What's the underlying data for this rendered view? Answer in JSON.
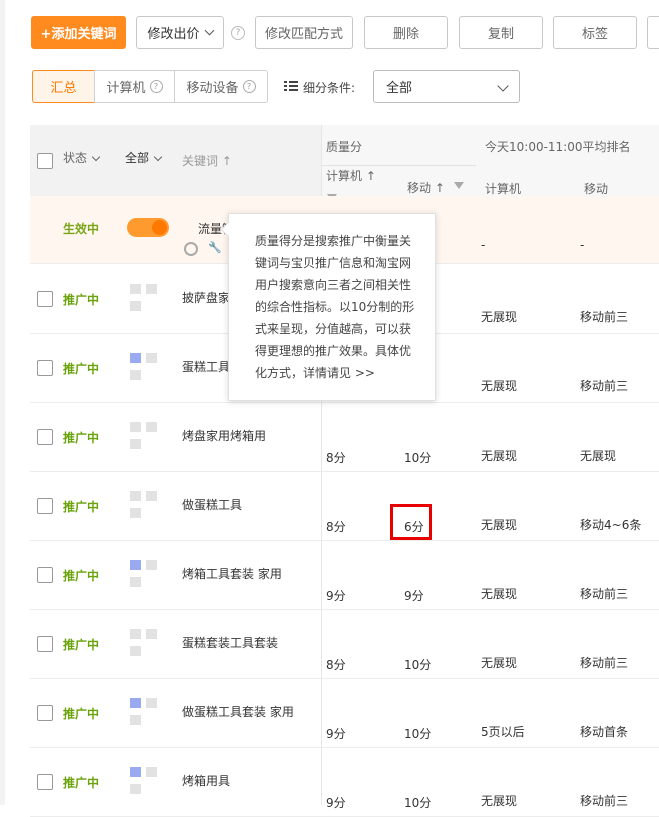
{
  "toolbar": {
    "add_label": "+添加关键词",
    "modify_bid_label": "修改出价",
    "modify_match_label": "修改匹配方式",
    "delete_label": "删除",
    "copy_label": "复制",
    "tag_label": "标签"
  },
  "filters": {
    "seg_summary": "汇总",
    "seg_computer": "计算机",
    "seg_mobile": "移动设备",
    "condition_label": "细分条件:",
    "condition_value": "全部"
  },
  "table": {
    "header": {
      "status": "状态",
      "all": "全部",
      "keyword": "关键词 ↑",
      "quality": "质量分",
      "quality_computer": "计算机 ↑",
      "quality_mobile": "移动 ↑",
      "rank_group": "今天10:00-11:00平均排名",
      "rank_computer": "计算机",
      "rank_mobile": "移动"
    },
    "first_row": {
      "status": "生效中",
      "keyword": "流量智",
      "rank_computer": "-",
      "rank_mobile": "-"
    },
    "rows": [
      {
        "status": "推广中",
        "keyword": "披萨盘家",
        "q_pc": "",
        "q_mobile": "",
        "rank_pc": "无展现",
        "rank_mobile": "移动前三"
      },
      {
        "status": "推广中",
        "keyword": "蛋糕工具",
        "q_pc": "",
        "q_mobile": "",
        "rank_pc": "无展现",
        "rank_mobile": "移动前三"
      },
      {
        "status": "推广中",
        "keyword": "烤盘家用烤箱用",
        "q_pc": "8分",
        "q_mobile": "10分",
        "rank_pc": "无展现",
        "rank_mobile": "无展现"
      },
      {
        "status": "推广中",
        "keyword": "做蛋糕工具",
        "q_pc": "8分",
        "q_mobile": "6分",
        "rank_pc": "无展现",
        "rank_mobile": "移动4~6条"
      },
      {
        "status": "推广中",
        "keyword": "烤箱工具套装 家用",
        "q_pc": "9分",
        "q_mobile": "9分",
        "rank_pc": "无展现",
        "rank_mobile": "移动前三"
      },
      {
        "status": "推广中",
        "keyword": "蛋糕套装工具套装",
        "q_pc": "8分",
        "q_mobile": "10分",
        "rank_pc": "无展现",
        "rank_mobile": "移动前三"
      },
      {
        "status": "推广中",
        "keyword": "做蛋糕工具套装 家用",
        "q_pc": "9分",
        "q_mobile": "10分",
        "rank_pc": "5页以后",
        "rank_mobile": "移动首条"
      },
      {
        "status": "推广中",
        "keyword": "烤箱用具",
        "q_pc": "9分",
        "q_mobile": "10分",
        "rank_pc": "无展现",
        "rank_mobile": "移动前三"
      }
    ]
  },
  "tooltip": {
    "text": "质量得分是搜索推广中衡量关键词与宝贝推广信息和淘宝网用户搜索意向三者之间相关性的综合性指标。以10分制的形式来呈现，分值越高，可以获得更理想的推广效果。具体优化方式，详情请见 >>"
  },
  "colors": {
    "accent": "#ff8a1e",
    "status_green": "#6aa30c",
    "highlight": "#e80000"
  }
}
